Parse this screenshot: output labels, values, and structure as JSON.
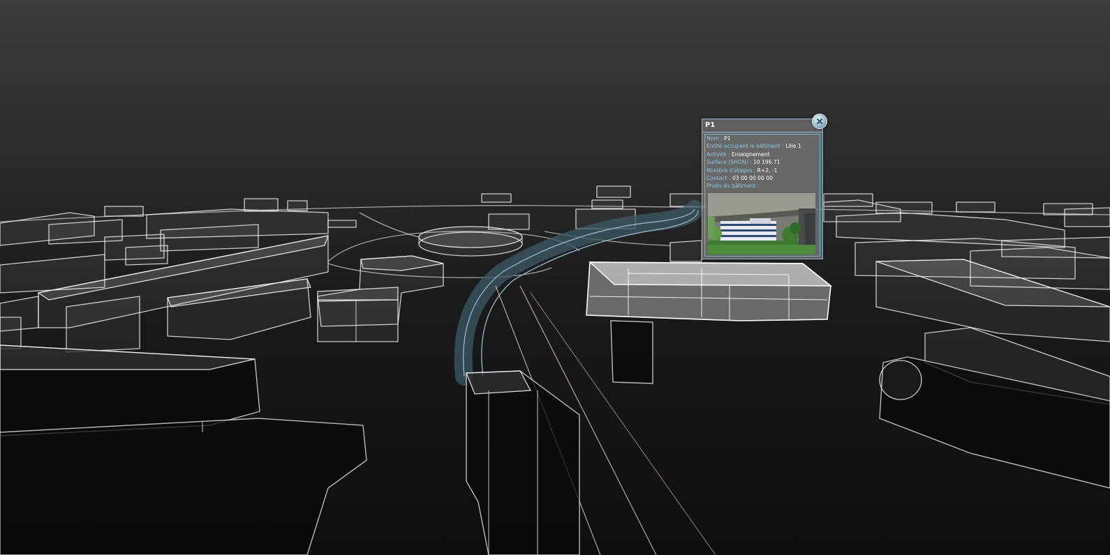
{
  "popup": {
    "title": "P1",
    "rows": [
      {
        "label": "Nom :",
        "value": "P1"
      },
      {
        "label": "Entité occupant le bâtiment :",
        "value": "Lille 1"
      },
      {
        "label": "Activité :",
        "value": "Enseignement"
      },
      {
        "label": "Surface (SHON) :",
        "value": "10 196.71"
      },
      {
        "label": "Nombre d'étages :",
        "value": "R+2, -1"
      },
      {
        "label": "Contact :",
        "value": "03 00 00 00 00"
      },
      {
        "label": "Photo du bâtiment :",
        "value": ""
      }
    ],
    "close_icon": "close-icon"
  },
  "colors": {
    "accent_border": "#8fb9c9",
    "label_text": "#8ec9e0",
    "value_text": "#ffffff",
    "tram_track": "#5f7f8c"
  }
}
